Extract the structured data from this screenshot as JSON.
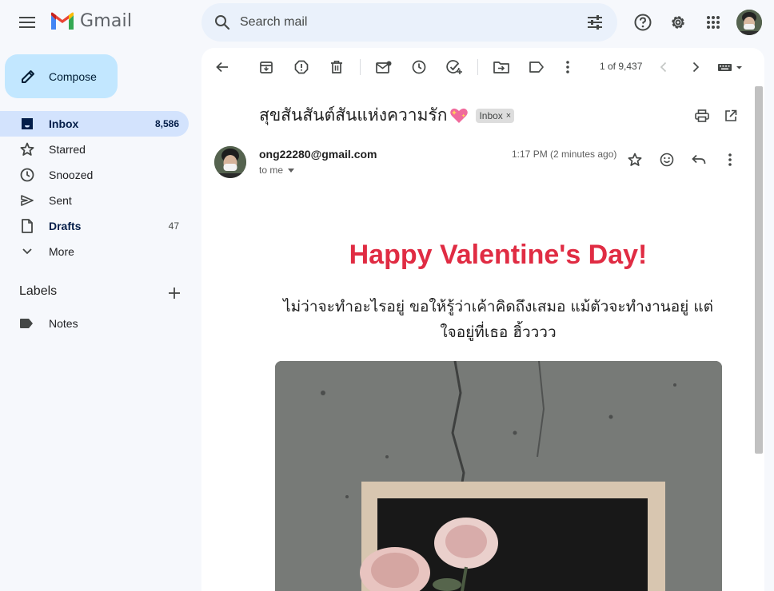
{
  "app": {
    "name": "Gmail"
  },
  "search": {
    "placeholder": "Search mail"
  },
  "compose": {
    "label": "Compose"
  },
  "sidebar": {
    "items": [
      {
        "label": "Inbox",
        "count": "8,586",
        "icon": "inbox-icon"
      },
      {
        "label": "Starred",
        "count": "",
        "icon": "star-icon"
      },
      {
        "label": "Snoozed",
        "count": "",
        "icon": "clock-icon"
      },
      {
        "label": "Sent",
        "count": "",
        "icon": "send-icon"
      },
      {
        "label": "Drafts",
        "count": "47",
        "icon": "draft-icon"
      },
      {
        "label": "More",
        "count": "",
        "icon": "chevron-down-icon"
      }
    ],
    "labels_heading": "Labels",
    "labels": [
      {
        "label": "Notes",
        "icon": "label-icon"
      }
    ]
  },
  "toolbar": {
    "pager": "1 of 9,437"
  },
  "email": {
    "subject": "สุขสันสันต์สันแห่งความรัก",
    "inbox_chip": "Inbox",
    "chip_close": "×",
    "sender": "ong22280@gmail.com",
    "recipient": "to me",
    "time": "1:17 PM (2 minutes ago)",
    "body_title": "Happy Valentine's Day!",
    "body_text": "ไม่ว่าจะทำอะไรอยู่ ขอให้รู้ว่าเค้าคิดถึงเสมอ แม้ตัวจะทำงานอยู่ แต่ใจอยู่ที่เธอ ฮิ้วววว"
  },
  "colors": {
    "compose_bg": "#c2e7ff",
    "active_nav": "#d3e3fd",
    "search_bg": "#eaf1fb",
    "accent_red": "#e02c43"
  }
}
